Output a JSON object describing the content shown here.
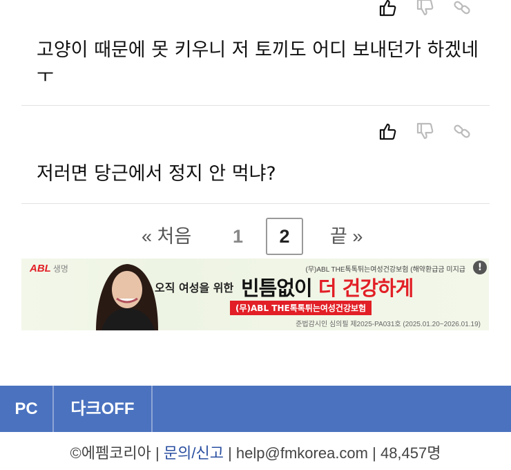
{
  "comments": [
    {
      "text": "고양이 때문에 못 키우니 저 토끼도 어디 보내던가 하겠네ㅜ"
    },
    {
      "text": "저러면 당근에서 정지 안 먹냐?"
    }
  ],
  "icons": {
    "like": "thumbs-up-icon",
    "dislike": "thumbs-down-icon",
    "link": "link-icon"
  },
  "pagination": {
    "first_label": "« 처음",
    "pages": [
      "1",
      "2"
    ],
    "current_page": "2",
    "last_label": "끝 »"
  },
  "ad": {
    "brand": "ABL",
    "brand_suffix": "생명",
    "top_text": "(무)ABL THE톡톡튀는여성건강보험 (해약환급금 미지급",
    "subtitle": "오직 여성을 위한",
    "headline_black": "빈틈없이",
    "headline_red": "더 건강하게",
    "tag": "(무)ABL THE톡톡튀는여성건강보험",
    "note": "준법감시인 심의필 제2025-PA031호 (2025.01.20~2026.01.19)",
    "info_icon": "!"
  },
  "footer_bar": {
    "pc_label": "PC",
    "dark_label": "다크OFF",
    "color": "#4a72bf"
  },
  "footer": {
    "copyright": "©에펨코리아",
    "sep1": " | ",
    "report_link": "문의/신고",
    "sep2": " | ",
    "email": "help@fmkorea.com",
    "sep3": " | ",
    "users": "48,457명"
  }
}
